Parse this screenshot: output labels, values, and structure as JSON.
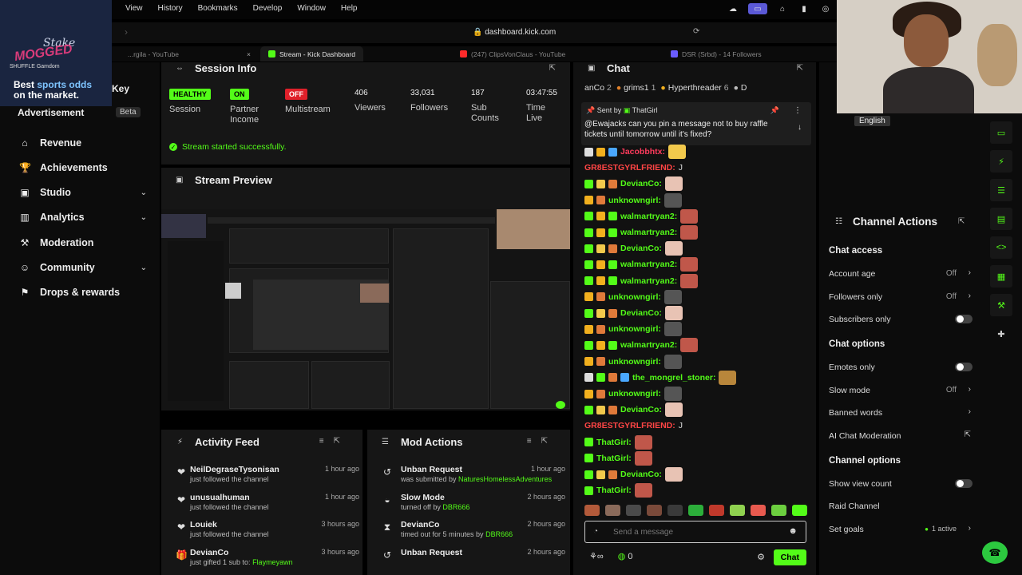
{
  "menubar": {
    "items": [
      "View",
      "History",
      "Bookmarks",
      "Develop",
      "Window",
      "Help"
    ]
  },
  "browser": {
    "url": "dashboard.kick.com",
    "tabs": [
      {
        "label": "...rgila - YouTube",
        "color": "#cc0000"
      },
      {
        "label": "Stream - Kick Dashboard",
        "color": "#53fc18"
      },
      {
        "label": "(247) ClipsVonClaus - YouTube",
        "color": "#ff2a2a"
      },
      {
        "label": "DSR (Srbd) - 14 Followers",
        "color": "#6a5cff"
      }
    ]
  },
  "ad": {
    "brand": "Stake",
    "overlay": "MOGGED",
    "partners": "SHUFFLE   Gamdom",
    "tagline_1": "Best",
    "tagline_blue": "sports odds",
    "tagline_2": "on the market."
  },
  "sidebar": {
    "key_label": "Key",
    "partial_label": "Advertisement",
    "beta": "Beta",
    "items": [
      {
        "label": "Revenue",
        "icon": "bank-icon",
        "chev": false
      },
      {
        "label": "Achievements",
        "icon": "trophy-icon",
        "chev": false
      },
      {
        "label": "Studio",
        "icon": "studio-icon",
        "chev": true
      },
      {
        "label": "Analytics",
        "icon": "analytics-icon",
        "chev": true
      },
      {
        "label": "Moderation",
        "icon": "wrench-icon",
        "chev": false
      },
      {
        "label": "Community",
        "icon": "community-icon",
        "chev": true
      },
      {
        "label": "Drops & rewards",
        "icon": "drops-icon",
        "chev": false
      }
    ]
  },
  "session": {
    "title": "Session Info",
    "health": {
      "value": "HEALTHY",
      "label": "Session"
    },
    "partner": {
      "value": "ON",
      "label_1": "Partner",
      "label_2": "Income"
    },
    "multistream": {
      "value": "OFF",
      "label": "Multistream"
    },
    "viewers": {
      "value": "406",
      "label": "Viewers"
    },
    "followers": {
      "value": "33,031",
      "label": "Followers"
    },
    "subs": {
      "value": "187",
      "label_1": "Sub",
      "label_2": "Counts"
    },
    "time": {
      "value": "03:47:55",
      "label_1": "Time",
      "label_2": "Live"
    },
    "status_message": "Stream started successfully."
  },
  "preview": {
    "title": "Stream Preview"
  },
  "activity": {
    "title": "Activity Feed",
    "items": [
      {
        "name": "NeilDegraseTysonisan",
        "desc": "just followed the channel",
        "time": "1 hour ago",
        "icon": "heart-icon"
      },
      {
        "name": "unusualhuman",
        "desc": "just followed the channel",
        "time": "1 hour ago",
        "icon": "heart-icon"
      },
      {
        "name": "Louiek",
        "desc": "just followed the channel",
        "time": "3 hours ago",
        "icon": "heart-icon"
      },
      {
        "name": "DevianCo",
        "desc": "just gifted 1 sub to:",
        "target": "Flaymeyawn",
        "time": "3 hours ago",
        "icon": "gift-icon"
      }
    ]
  },
  "mod": {
    "title": "Mod Actions",
    "items": [
      {
        "name": "Unban Request",
        "desc": "was submitted by",
        "target": "NaturesHomelessAdventures",
        "time": "1 hour ago",
        "icon": "undo-icon"
      },
      {
        "name": "Slow Mode",
        "desc": "turned off by",
        "target": "DBR666",
        "time": "2 hours ago",
        "icon": "slow-icon"
      },
      {
        "name": "DevianCo",
        "desc": "timed out for 5 minutes by",
        "target": "DBR666",
        "time": "2 hours ago",
        "icon": "hourglass-icon"
      },
      {
        "name": "Unban Request",
        "desc": "",
        "target": "",
        "time": "2 hours ago",
        "icon": "undo-icon"
      }
    ]
  },
  "chat": {
    "title": "Chat",
    "top_chatters": [
      {
        "name": "anCo",
        "count": "2"
      },
      {
        "name": "grims1",
        "count": "1"
      },
      {
        "name": "Hyperthreader",
        "count": "6"
      },
      {
        "name": "D",
        "count": ""
      }
    ],
    "pinned": {
      "sent_by": "Sent by",
      "user": "ThatGirl",
      "message": "@Ewajacks can you pin a message not to buy raffle tickets until tomorrow until it's fixed?"
    },
    "messages": [
      {
        "user": "Jacobbhtx:",
        "color": "#ff3b5c",
        "emote": "#f2c94c"
      },
      {
        "user": "GR8ESTGYRLFRIEND:",
        "color": "#ff4545",
        "text": "J"
      },
      {
        "user": "DevianCo:",
        "color": "#53fc18",
        "emote": "#e8c3b4"
      },
      {
        "user": "unknowngirl:",
        "color": "#53fc18",
        "emote": "#555"
      },
      {
        "user": "walmartryan2:",
        "color": "#53fc18",
        "emote": "#c0574a"
      },
      {
        "user": "walmartryan2:",
        "color": "#53fc18",
        "emote": "#c0574a"
      },
      {
        "user": "DevianCo:",
        "color": "#53fc18",
        "emote": "#e8c3b4"
      },
      {
        "user": "walmartryan2:",
        "color": "#53fc18",
        "emote": "#c0574a"
      },
      {
        "user": "walmartryan2:",
        "color": "#53fc18",
        "emote": "#c0574a"
      },
      {
        "user": "unknowngirl:",
        "color": "#53fc18",
        "emote": "#555"
      },
      {
        "user": "DevianCo:",
        "color": "#53fc18",
        "emote": "#e8c3b4"
      },
      {
        "user": "unknowngirl:",
        "color": "#53fc18",
        "emote": "#555"
      },
      {
        "user": "walmartryan2:",
        "color": "#53fc18",
        "emote": "#c0574a"
      },
      {
        "user": "unknowngirl:",
        "color": "#53fc18",
        "emote": "#555"
      },
      {
        "user": "the_mongrel_stoner:",
        "color": "#53fc18",
        "emote": "#b8863b"
      },
      {
        "user": "unknowngirl:",
        "color": "#53fc18",
        "emote": "#555"
      },
      {
        "user": "DevianCo:",
        "color": "#53fc18",
        "emote": "#e8c3b4"
      },
      {
        "user": "GR8ESTGYRLFRIEND:",
        "color": "#ff4545",
        "text": "J"
      },
      {
        "user": "ThatGirl:",
        "color": "#53fc18",
        "emote": "#c0574a"
      },
      {
        "user": "ThatGirl:",
        "color": "#53fc18",
        "emote": "#c0574a"
      },
      {
        "user": "DevianCo:",
        "color": "#53fc18",
        "emote": "#e8c3b4"
      },
      {
        "user": "ThatGirl:",
        "color": "#53fc18",
        "emote": "#c0574a"
      }
    ],
    "placeholder": "Send a message",
    "count": "0",
    "send": "Chat"
  },
  "cam": {
    "language": "English"
  },
  "actions": {
    "title": "Channel Actions",
    "rows": [
      {
        "label": "Chat access",
        "type": "header"
      },
      {
        "label": "Account age",
        "value": "Off",
        "type": "chev"
      },
      {
        "label": "Followers only",
        "value": "Off",
        "type": "chev"
      },
      {
        "label": "Subscribers only",
        "type": "toggle"
      },
      {
        "label": "Chat options",
        "type": "header"
      },
      {
        "label": "Emotes only",
        "type": "toggle"
      },
      {
        "label": "Slow mode",
        "value": "Off",
        "type": "chev"
      },
      {
        "label": "Banned words",
        "type": "chev"
      },
      {
        "label": "AI Chat Moderation",
        "type": "link"
      },
      {
        "label": "Channel options",
        "type": "header"
      },
      {
        "label": "Show view count",
        "type": "toggle"
      },
      {
        "label": "Raid Channel",
        "type": "plain"
      },
      {
        "label": "Set goals",
        "active": "1 active",
        "type": "active"
      }
    ]
  },
  "colors": {
    "kick_green": "#53fc18",
    "panel": "#161616",
    "healthy": "#53fc18",
    "off": "#e0202a"
  }
}
